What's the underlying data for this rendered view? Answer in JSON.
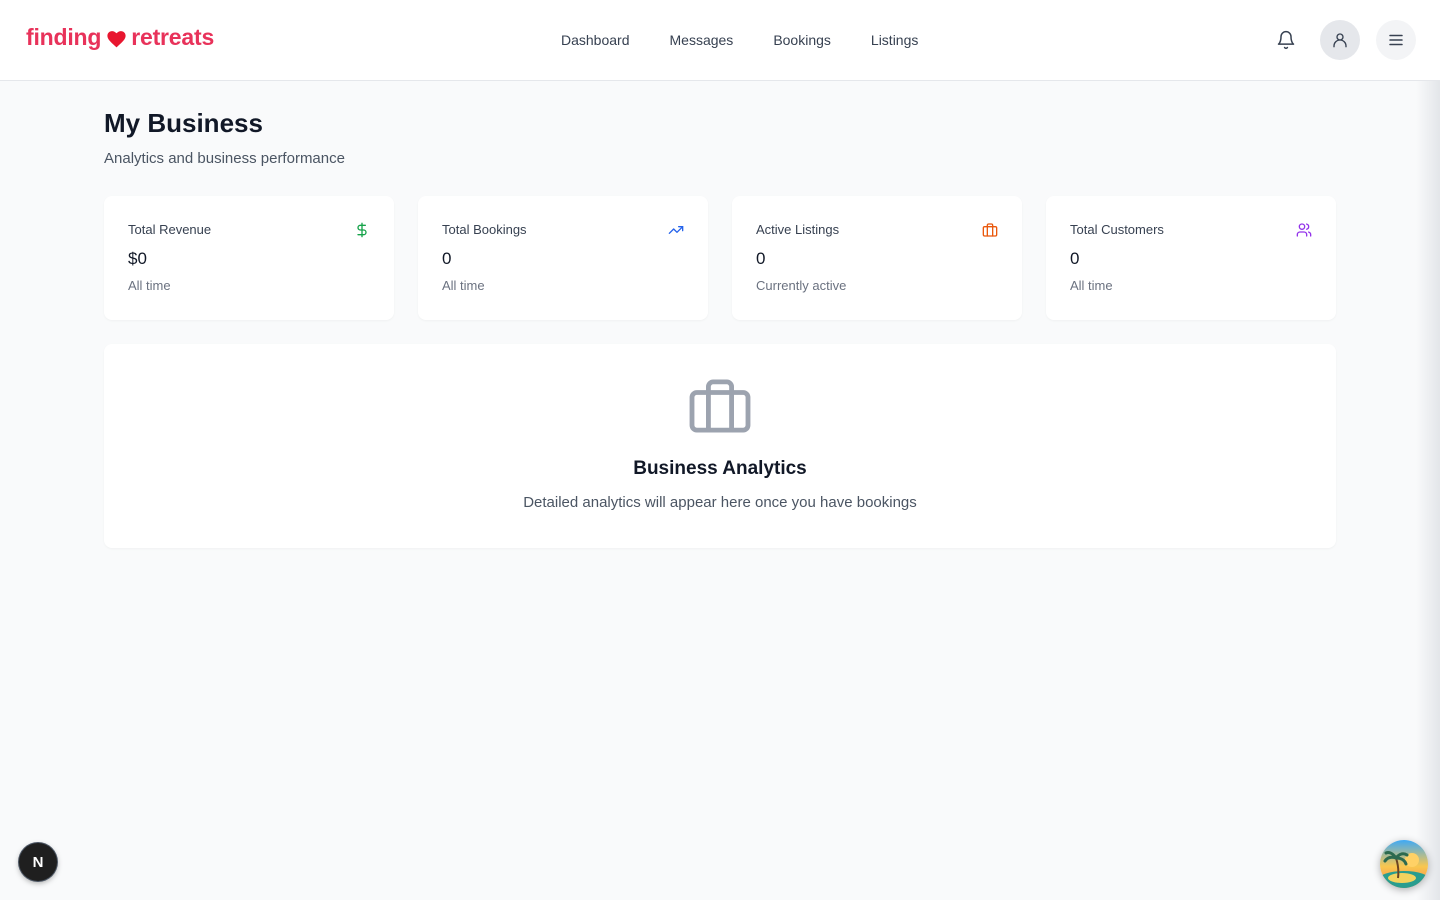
{
  "header": {
    "logo_left": "finding",
    "logo_right": "retreats",
    "nav": [
      {
        "label": "Dashboard"
      },
      {
        "label": "Messages"
      },
      {
        "label": "Bookings"
      },
      {
        "label": "Listings"
      }
    ],
    "icons": {
      "notifications": "bell-icon",
      "profile": "user-icon",
      "menu": "hamburger-menu-icon"
    }
  },
  "page": {
    "title": "My Business",
    "subtitle": "Analytics and business performance"
  },
  "stats": [
    {
      "label": "Total Revenue",
      "value": "$0",
      "note": "All time",
      "icon": "dollar-icon",
      "color": "#16a34a"
    },
    {
      "label": "Total Bookings",
      "value": "0",
      "note": "All time",
      "icon": "trending-up-icon",
      "color": "#2563eb"
    },
    {
      "label": "Active Listings",
      "value": "0",
      "note": "Currently active",
      "icon": "briefcase-icon",
      "color": "#ea580c"
    },
    {
      "label": "Total Customers",
      "value": "0",
      "note": "All time",
      "icon": "users-icon",
      "color": "#9333ea"
    }
  ],
  "analytics": {
    "title": "Business Analytics",
    "description": "Detailed analytics will appear here once you have bookings",
    "icon": "briefcase-icon"
  },
  "floating": {
    "dev_badge_letter": "N",
    "assistant_icon": "island-avatar-icon"
  },
  "colors": {
    "brand": "#e8325a",
    "page_background": "#f9fafb",
    "muted_icon": "#9ca3af"
  }
}
